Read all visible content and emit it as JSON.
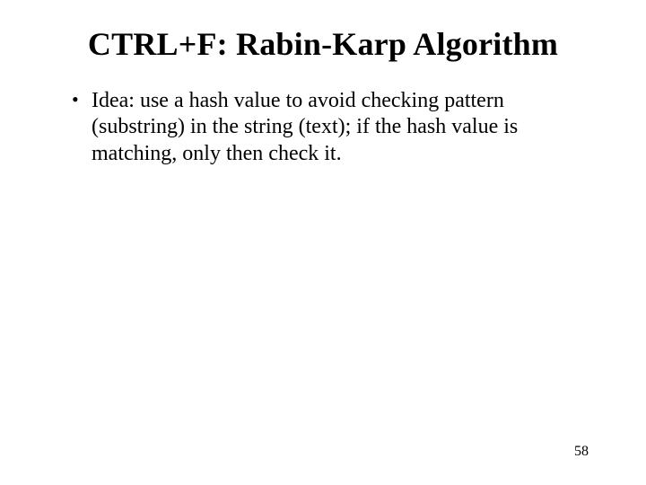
{
  "slide": {
    "title": "CTRL+F: Rabin-Karp Algorithm",
    "bullets": [
      "Idea: use a hash value to avoid checking pattern (substring) in the string (text); if the hash value is matching, only then check it."
    ],
    "page_number": "58"
  }
}
